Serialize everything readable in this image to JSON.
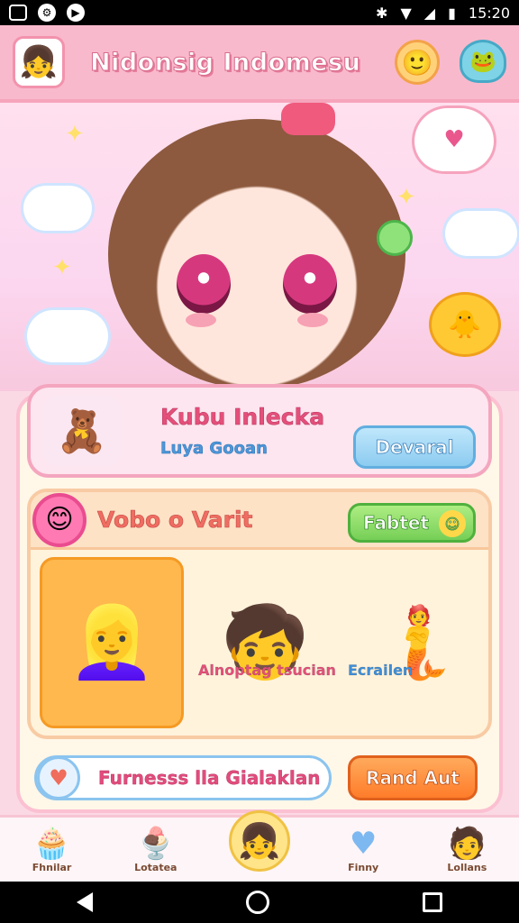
{
  "status_bar": {
    "time": "15:20"
  },
  "app_bar": {
    "title": "Nidonsig Indomesu"
  },
  "featured": {
    "title": "Kubu Inlecka",
    "subtitle": "Luya Gooan",
    "button": "Devaral"
  },
  "section": {
    "title": "Vobo o Varit",
    "button": "Fabtet",
    "characters": [
      {
        "label": "",
        "selected": true
      },
      {
        "label": "Alnoptag tsucian",
        "selected": false
      },
      {
        "label": "Ecrailen",
        "selected": false
      }
    ]
  },
  "bottom_actions": {
    "pill_text": "Furnesss lla Gialaklan",
    "action_button": "Rand Aut"
  },
  "tabs": [
    {
      "label": "Fhnilar",
      "icon": "cake-icon"
    },
    {
      "label": "Lotatea",
      "icon": "dessert-icon"
    },
    {
      "label": "",
      "icon": "character-icon"
    },
    {
      "label": "Finny",
      "icon": "heart-icon"
    },
    {
      "label": "Lollans",
      "icon": "profile-icon"
    }
  ],
  "colors": {
    "accent_pink": "#f9b9cc",
    "title_pink": "#e4507a",
    "button_blue": "#8ccbf0",
    "button_green": "#76cf57",
    "button_orange": "#ff7c2a"
  }
}
